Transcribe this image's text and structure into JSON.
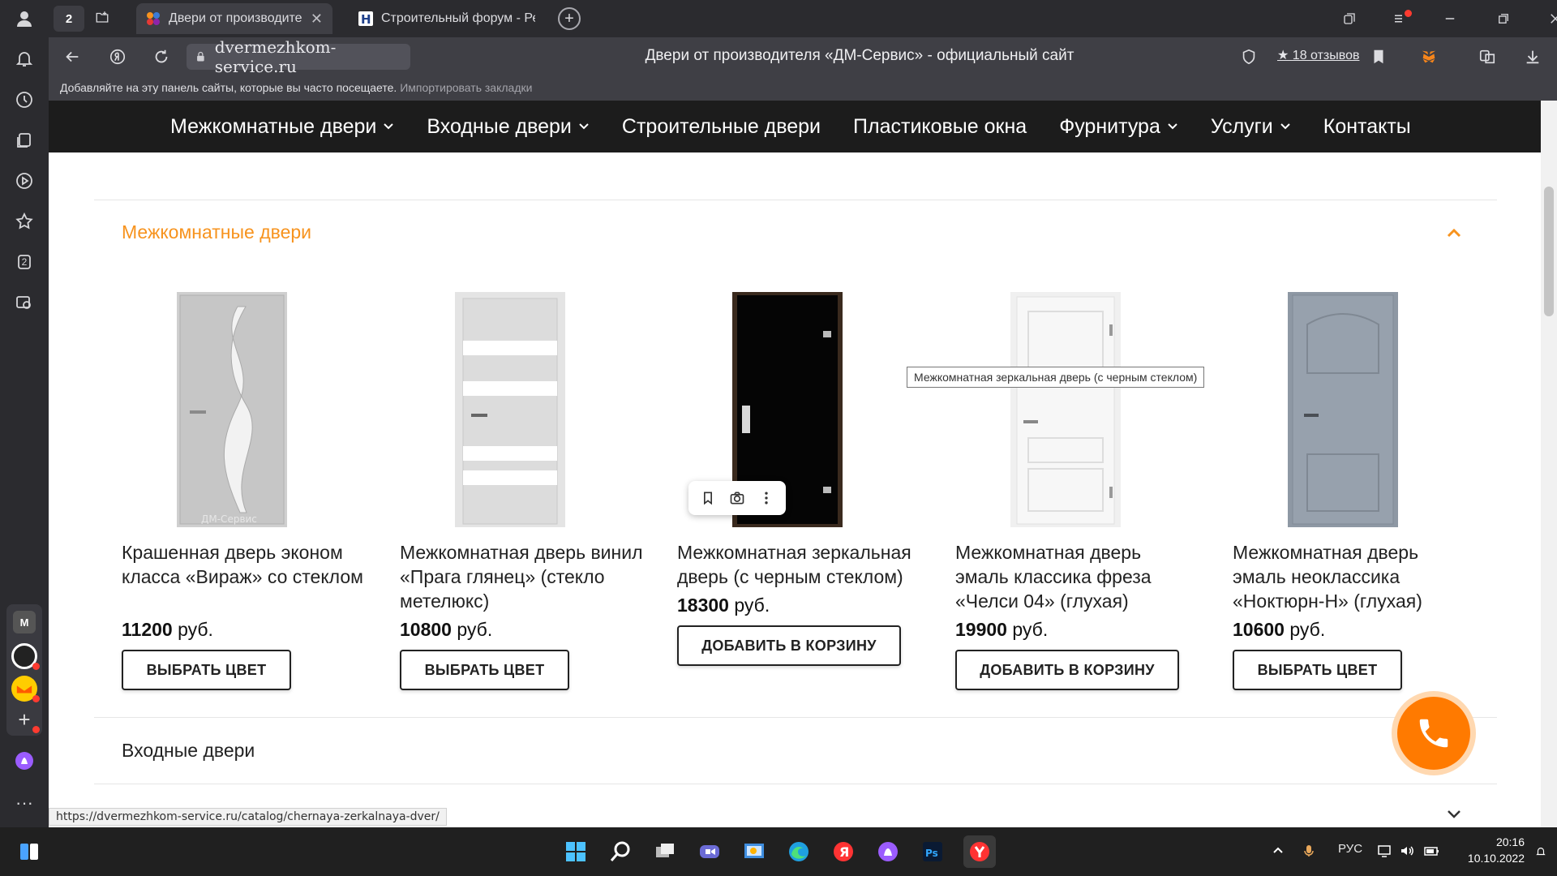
{
  "browser": {
    "tab_count": "2",
    "tabs": [
      {
        "title": "Двери от производите",
        "active": true
      },
      {
        "title": "Строительный форум - Ре",
        "active": false
      }
    ],
    "url": "dvermezhkom-service.ru",
    "page_title": "Двери от производителя «ДМ-Сервис» - официальный сайт",
    "reviews": "★ 18 отзывов",
    "bookmarks_hint": "Добавляйте на эту панель сайты, которые вы часто посещаете.",
    "bookmarks_link": "Импортировать закладки",
    "status_url": "https://dvermezhkom-service.ru/catalog/chernaya-zerkalnaya-dver/",
    "sidebar_badge": "2",
    "sidebar_app_m": "M"
  },
  "nav": {
    "items": [
      {
        "label": "Межкомнатные двери",
        "dropdown": true
      },
      {
        "label": "Входные двери",
        "dropdown": true
      },
      {
        "label": "Строительные двери",
        "dropdown": false
      },
      {
        "label": "Пластиковые окна",
        "dropdown": false
      },
      {
        "label": "Фурнитура",
        "dropdown": true
      },
      {
        "label": "Услуги",
        "dropdown": true
      },
      {
        "label": "Контакты",
        "dropdown": false
      }
    ]
  },
  "catalog": {
    "section_title": "Межкомнатные двери",
    "section2_title": "Входные двери",
    "currency": "руб.",
    "tooltip": "Межкомнатная зеркальная дверь (с черным стеклом)",
    "products": [
      {
        "name": "Крашенная дверь эконом класса «Вираж» со стеклом",
        "price": "11200",
        "button": "ВЫБРАТЬ ЦВЕТ",
        "watermark": "ДМ-Сервис"
      },
      {
        "name": "Межкомнатная дверь винил «Прага глянец» (стекло метелюкс)",
        "price": "10800",
        "button": "ВЫБРАТЬ ЦВЕТ"
      },
      {
        "name": "Межкомнатная зеркальная дверь (с черным стеклом)",
        "price": "18300",
        "button": "ДОБАВИТЬ В КОРЗИНУ"
      },
      {
        "name": "Межкомнатная дверь эмаль классика фреза «Челси 04» (глухая)",
        "price": "19900",
        "button": "ДОБАВИТЬ В КОРЗИНУ"
      },
      {
        "name": "Межкомнатная дверь эмаль неоклассика «Ноктюрн-Н» (глухая)",
        "price": "10600",
        "button": "ВЫБРАТЬ ЦВЕТ"
      }
    ]
  },
  "taskbar": {
    "lang": "РУС",
    "time": "20:16",
    "date": "10.10.2022"
  },
  "colors": {
    "accent_orange": "#f7931e",
    "call_orange": "#ff7a00",
    "nav_bg": "#1c1c1c"
  }
}
